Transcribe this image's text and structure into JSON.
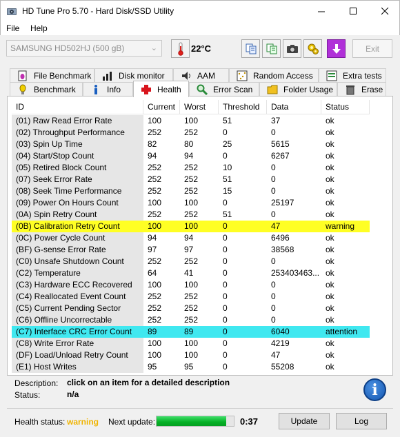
{
  "window": {
    "title": "HD Tune Pro 5.70 - Hard Disk/SSD Utility"
  },
  "menu": {
    "file": "File",
    "help": "Help"
  },
  "toolbar": {
    "drive": "SAMSUNG HD502HJ (500 gB)",
    "temperature": "22°C",
    "exit_label": "Exit"
  },
  "tabs_top": [
    {
      "label": "File Benchmark",
      "icon": "file-benchmark-icon"
    },
    {
      "label": "Disk monitor",
      "icon": "disk-monitor-icon"
    },
    {
      "label": "AAM",
      "icon": "speaker-icon"
    },
    {
      "label": "Random Access",
      "icon": "random-access-icon"
    },
    {
      "label": "Extra tests",
      "icon": "extra-tests-icon"
    }
  ],
  "tabs_bottom": [
    {
      "label": "Benchmark",
      "icon": "benchmark-icon"
    },
    {
      "label": "Info",
      "icon": "info-icon"
    },
    {
      "label": "Health",
      "icon": "health-cross-icon"
    },
    {
      "label": "Error Scan",
      "icon": "magnifier-icon"
    },
    {
      "label": "Folder Usage",
      "icon": "folder-icon"
    },
    {
      "label": "Erase",
      "icon": "trash-icon"
    }
  ],
  "table": {
    "headers": [
      "ID",
      "Current",
      "Worst",
      "Threshold",
      "Data",
      "Status"
    ],
    "rows": [
      [
        "(01) Raw Read Error Rate",
        "100",
        "100",
        "51",
        "37",
        "ok"
      ],
      [
        "(02) Throughput Performance",
        "252",
        "252",
        "0",
        "0",
        "ok"
      ],
      [
        "(03) Spin Up Time",
        "82",
        "80",
        "25",
        "5615",
        "ok"
      ],
      [
        "(04) Start/Stop Count",
        "94",
        "94",
        "0",
        "6267",
        "ok"
      ],
      [
        "(05) Retired Block Count",
        "252",
        "252",
        "10",
        "0",
        "ok"
      ],
      [
        "(07) Seek Error Rate",
        "252",
        "252",
        "51",
        "0",
        "ok"
      ],
      [
        "(08) Seek Time Performance",
        "252",
        "252",
        "15",
        "0",
        "ok"
      ],
      [
        "(09) Power On Hours Count",
        "100",
        "100",
        "0",
        "25197",
        "ok"
      ],
      [
        "(0A) Spin Retry Count",
        "252",
        "252",
        "51",
        "0",
        "ok"
      ],
      [
        "(0B) Calibration Retry Count",
        "100",
        "100",
        "0",
        "47",
        "warning"
      ],
      [
        "(0C) Power Cycle Count",
        "94",
        "94",
        "0",
        "6496",
        "ok"
      ],
      [
        "(BF) G-sense Error Rate",
        "97",
        "97",
        "0",
        "38568",
        "ok"
      ],
      [
        "(C0) Unsafe Shutdown Count",
        "252",
        "252",
        "0",
        "0",
        "ok"
      ],
      [
        "(C2) Temperature",
        "64",
        "41",
        "0",
        "253403463...",
        "ok"
      ],
      [
        "(C3) Hardware ECC Recovered",
        "100",
        "100",
        "0",
        "0",
        "ok"
      ],
      [
        "(C4) Reallocated Event Count",
        "252",
        "252",
        "0",
        "0",
        "ok"
      ],
      [
        "(C5) Current Pending Sector",
        "252",
        "252",
        "0",
        "0",
        "ok"
      ],
      [
        "(C6) Offline Uncorrectable",
        "252",
        "252",
        "0",
        "0",
        "ok"
      ],
      [
        "(C7) Interface CRC Error Count",
        "89",
        "89",
        "0",
        "6040",
        "attention"
      ],
      [
        "(C8) Write Error Rate",
        "100",
        "100",
        "0",
        "4219",
        "ok"
      ],
      [
        "(DF) Load/Unload Retry Count",
        "100",
        "100",
        "0",
        "47",
        "ok"
      ],
      [
        "(E1) Host Writes",
        "95",
        "95",
        "0",
        "55208",
        "ok"
      ]
    ]
  },
  "details": {
    "description_label": "Description:",
    "description_value": "click on an item for a detailed description",
    "status_label": "Status:",
    "status_value": "n/a"
  },
  "footer": {
    "health_label": "Health status:",
    "health_value": "warning",
    "next_update_label": "Next update:",
    "next_update_progress": 0.9,
    "timer": "0:37",
    "update_label": "Update",
    "log_label": "Log"
  },
  "colors": {
    "warning_row": "#ffff24",
    "attention_row": "#40e8f0",
    "health_warning": "#f0b400",
    "progress": "#06b025"
  }
}
